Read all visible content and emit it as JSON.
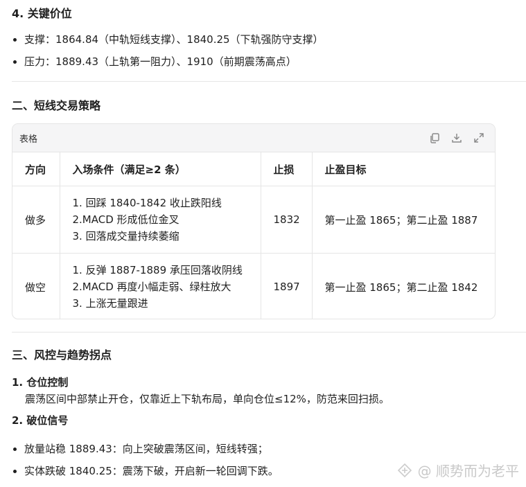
{
  "key_levels": {
    "title": "4. 关键价位",
    "items": [
      "支撑：1864.84（中轨短线支撑）、1840.25（下轨强防守支撑）",
      "压力：1889.43（上轨第一阻力）、1910（前期震荡高点）"
    ]
  },
  "strategy": {
    "title": "二、短线交易策略",
    "card_title": "表格",
    "tools": [
      "copy-icon",
      "download-icon",
      "expand-icon"
    ],
    "headers": [
      "方向",
      "入场条件（满足≥2 条）",
      "止损",
      "止盈目标"
    ],
    "rows": [
      {
        "direction": "做多",
        "conditions": [
          "1. 回踩 1840-1842 收止跌阳线",
          "2.MACD 形成低位金叉",
          "3. 回落成交量持续萎缩"
        ],
        "stop": "1832",
        "target": "第一止盈 1865；第二止盈 1887"
      },
      {
        "direction": "做空",
        "conditions": [
          "1. 反弹 1887-1889 承压回落收阴线",
          "2.MACD 再度小幅走弱、绿柱放大",
          "3. 上涨无量跟进"
        ],
        "stop": "1897",
        "target": "第一止盈 1865；第二止盈 1842"
      }
    ]
  },
  "risk": {
    "title": "三、风控与趋势拐点",
    "item1_title": "1. 仓位控制",
    "item1_desc": "震荡区间中部禁止开仓，仅靠近上下轨布局，单向仓位≤12%，防范来回扫损。",
    "item2_title": "2. 破位信号",
    "signals": [
      "放量站稳 1889.43：向上突破震荡区间，短线转强；",
      "实体跌破 1840.25：震荡下破，开启新一轮回调下跌。"
    ]
  },
  "watermark": {
    "text": "@ 顺势而为老平"
  }
}
